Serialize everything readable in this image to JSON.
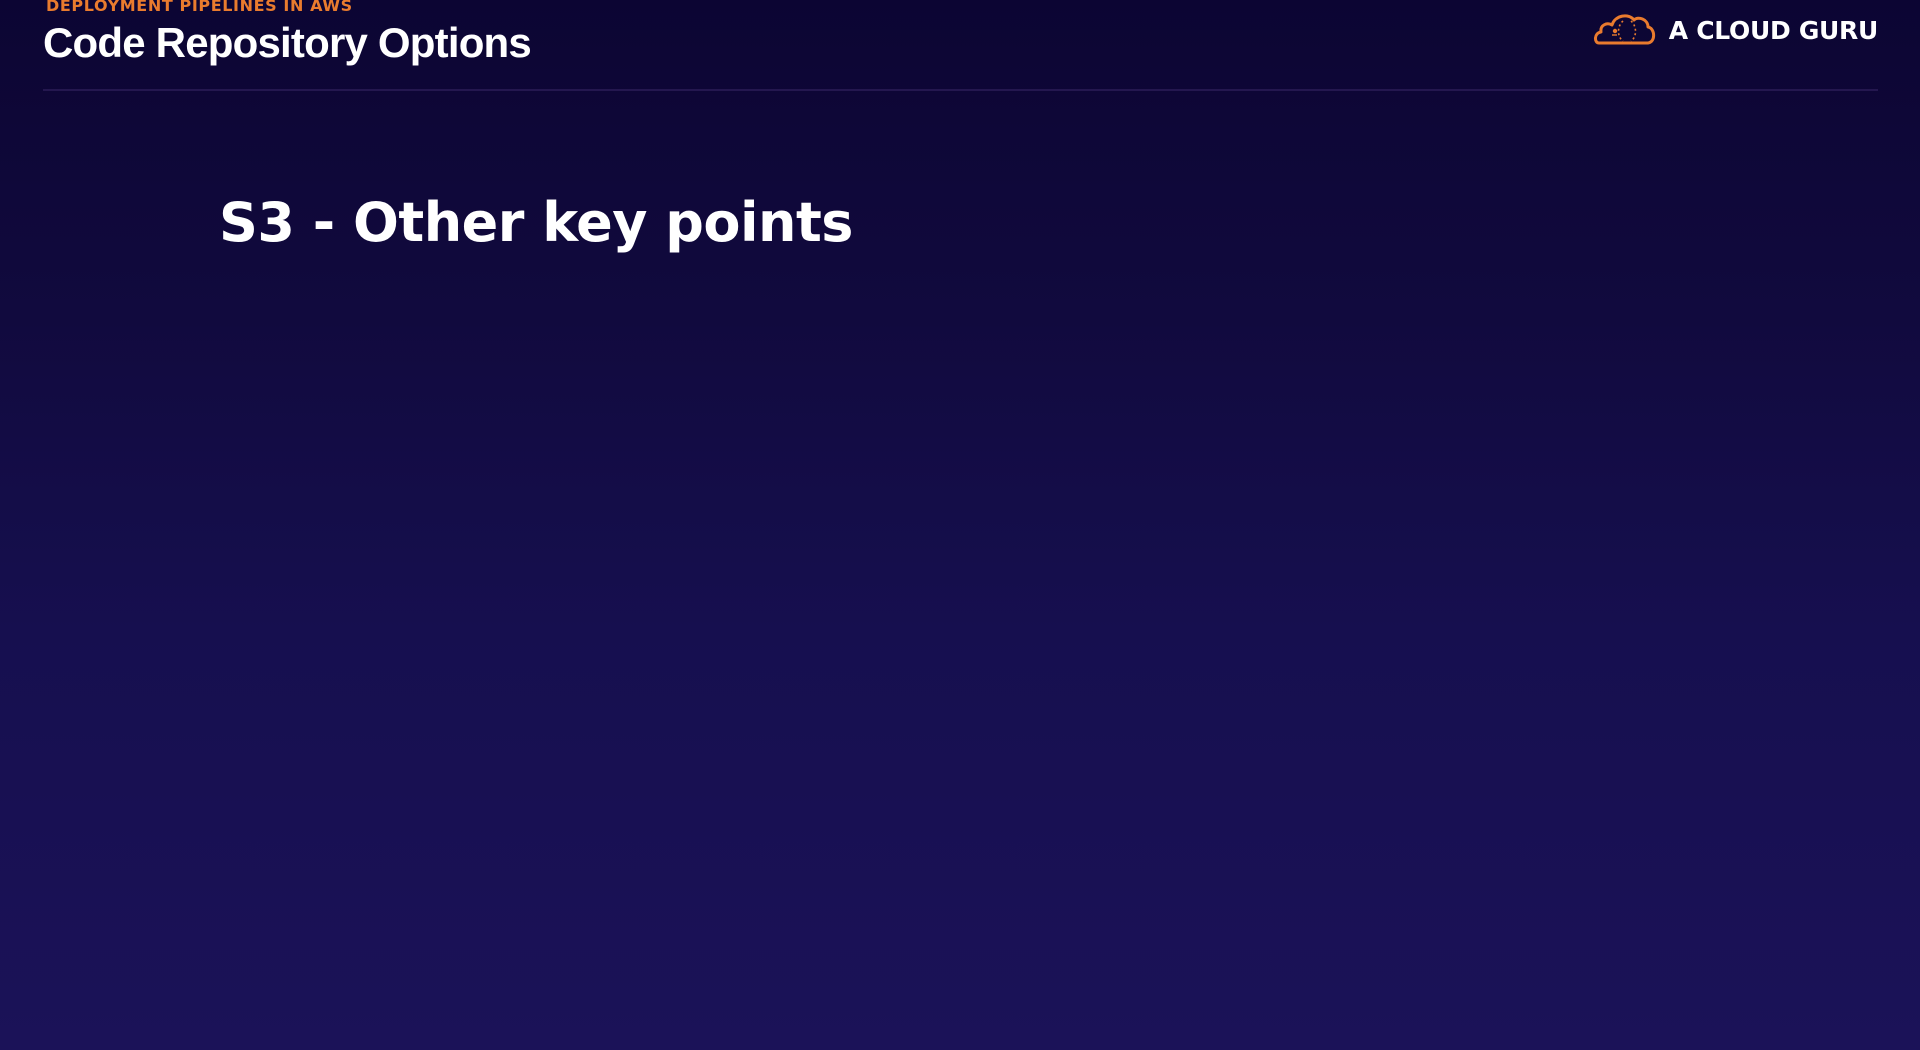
{
  "header": {
    "eyebrow": "DEPLOYMENT PIPELINES IN AWS",
    "title": "Code Repository Options"
  },
  "brand": {
    "name": "A CLOUD GURU",
    "icon": "cloud-guru-logo-icon",
    "icon_color": "#e97b2e"
  },
  "slide": {
    "heading": "S3 - Other key points"
  },
  "colors": {
    "background_top": "#0c0533",
    "background_bottom": "#1b1258",
    "accent": "#e97b2e",
    "text": "#ffffff"
  }
}
